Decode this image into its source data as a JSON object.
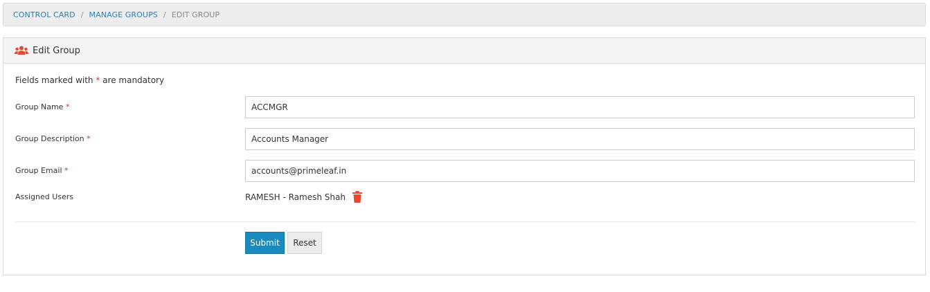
{
  "breadcrumb": {
    "items": [
      "CONTROL CARD",
      "MANAGE GROUPS"
    ],
    "current": "EDIT GROUP",
    "separator": "/"
  },
  "panel": {
    "title": "Edit Group",
    "icon": "users-icon"
  },
  "form": {
    "mandatory_prefix": "Fields marked with ",
    "mandatory_star": "*",
    "mandatory_suffix": " are mandatory",
    "fields": [
      {
        "label": "Group Name",
        "required": "*",
        "value": "ACCMGR"
      },
      {
        "label": "Group Description",
        "required": "*",
        "value": "Accounts Manager"
      },
      {
        "label": "Group Email",
        "required": "*",
        "value": "accounts@primeleaf.in"
      }
    ],
    "assigned_label": "Assigned Users",
    "assigned_users": [
      "RAMESH - Ramesh Shah"
    ],
    "submit_label": "Submit",
    "reset_label": "Reset"
  },
  "colors": {
    "link": "#2a7fb3",
    "required": "#d9302c",
    "primary_button": "#1a8bbf",
    "icon_accent": "#e8482b"
  }
}
